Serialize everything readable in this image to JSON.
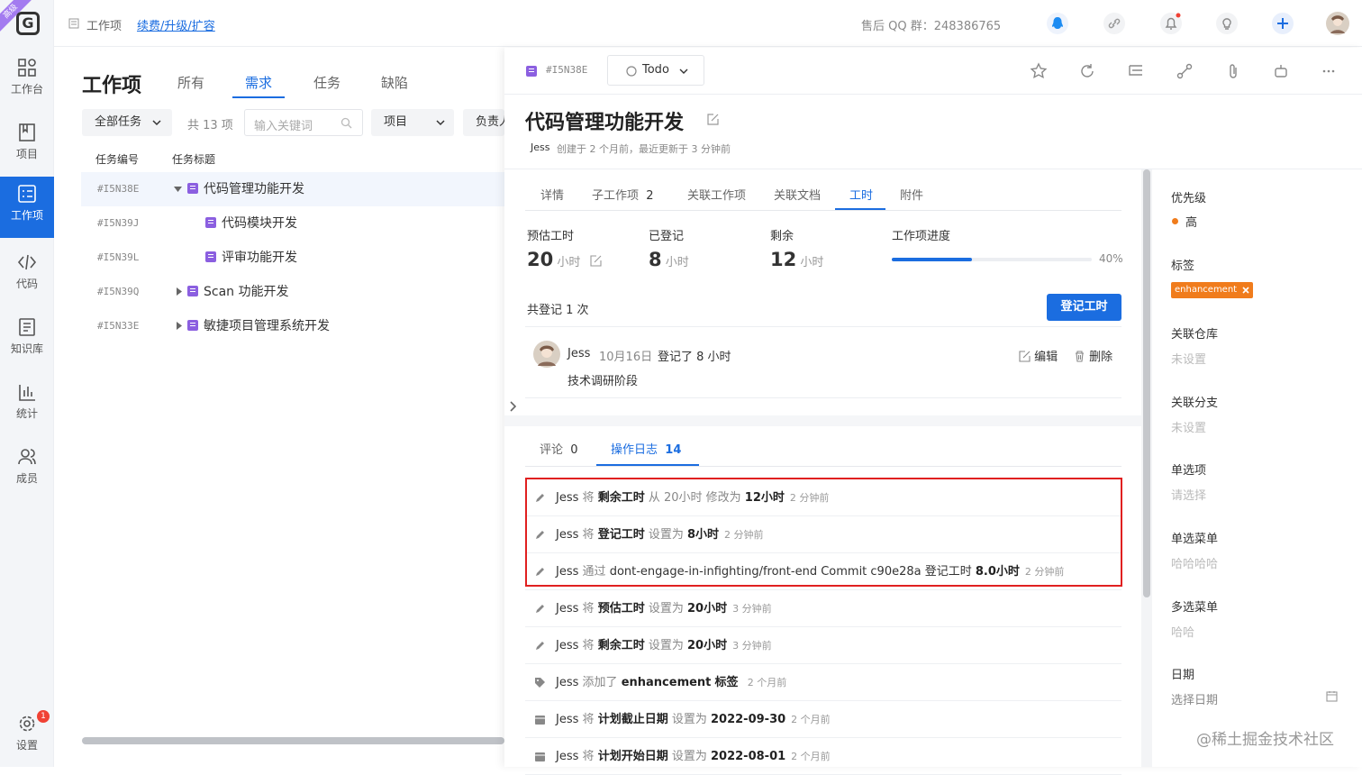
{
  "rail": {
    "corner_badge": "高级",
    "logo_letter": "G",
    "items": [
      {
        "label": "工作台",
        "icon": "dashboard-icon"
      },
      {
        "label": "项目",
        "icon": "project-icon"
      },
      {
        "label": "工作项",
        "icon": "workitem-icon",
        "active": true
      },
      {
        "label": "代码",
        "icon": "code-icon"
      },
      {
        "label": "知识库",
        "icon": "wiki-icon"
      },
      {
        "label": "统计",
        "icon": "chart-icon"
      },
      {
        "label": "成员",
        "icon": "members-icon"
      }
    ],
    "settings_label": "设置",
    "settings_badge": "1"
  },
  "topbar": {
    "crumb_root": "工作项",
    "crumb_link": "续费/升级/扩容",
    "qq_group": "售后 QQ 群：248386765"
  },
  "list": {
    "title": "工作项",
    "tabs": [
      "所有",
      "需求",
      "任务",
      "缺陷"
    ],
    "active_tab": 1,
    "filter_scope": "全部任务",
    "count": "共 13 项",
    "search_placeholder": "输入关键词",
    "project_filter": "项目",
    "assignee_filter": "负责人",
    "col_id": "任务编号",
    "col_title": "任务标题",
    "rows": [
      {
        "id": "#I5N38E",
        "title": "代码管理功能开发",
        "expand": "down",
        "level": 0
      },
      {
        "id": "#I5N39J",
        "title": "代码模块开发",
        "expand": "",
        "level": 1
      },
      {
        "id": "#I5N39L",
        "title": "评审功能开发",
        "expand": "",
        "level": 1
      },
      {
        "id": "#I5N39Q",
        "title": "Scan 功能开发",
        "expand": "right",
        "level": 0
      },
      {
        "id": "#I5N33E",
        "title": "敏捷项目管理系统开发",
        "expand": "right",
        "level": 0
      }
    ]
  },
  "detail": {
    "id": "#I5N38E",
    "status": "Todo",
    "title": "代码管理功能开发",
    "meta_author": "Jess",
    "meta_text": "创建于 2 个月前，最近更新于 3 分钟前",
    "tabs": [
      {
        "label": "详情"
      },
      {
        "label": "子工作项",
        "count": "2"
      },
      {
        "label": "关联工作项"
      },
      {
        "label": "关联文档"
      },
      {
        "label": "工时",
        "active": true
      },
      {
        "label": "附件"
      }
    ],
    "stats": {
      "estimate_label": "预估工时",
      "estimate_value": "20",
      "estimate_unit": "小时",
      "logged_label": "已登记",
      "logged_value": "8",
      "logged_unit": "小时",
      "remain_label": "剩余",
      "remain_value": "12",
      "remain_unit": "小时",
      "progress_label": "工作项进度",
      "progress_text": "40%",
      "progress_value": 0.4
    },
    "logged_count": "共登记 1 次",
    "log_button": "登记工时",
    "entry": {
      "user": "Jess",
      "date": "10月16日",
      "action": "登记了 8 小时",
      "note": "技术调研阶段",
      "edit": "编辑",
      "delete": "删除"
    },
    "activity_tabs": [
      {
        "label": "评论",
        "count": "0"
      },
      {
        "label": "操作日志",
        "count": "14",
        "active": true
      }
    ],
    "logs": [
      {
        "user": "Jess",
        "verb": "将",
        "field": "剩余工时",
        "mid": "从 20小时 修改为",
        "value": "12小时",
        "time": "2 分钟前",
        "icon": "pencil-icon"
      },
      {
        "user": "Jess",
        "verb": "将",
        "field": "登记工时",
        "mid": "设置为",
        "value": "8小时",
        "time": "2 分钟前",
        "icon": "pencil-icon"
      },
      {
        "user": "Jess",
        "verb": "通过",
        "field": "",
        "mid": "dont-engage-in-infighting/front-end Commit c90e28a 登记工时",
        "value": "8.0小时",
        "time": "2 分钟前",
        "icon": "pencil-icon"
      },
      {
        "user": "Jess",
        "verb": "将",
        "field": "预估工时",
        "mid": "设置为",
        "value": "20小时",
        "time": "3 分钟前",
        "icon": "pencil-icon"
      },
      {
        "user": "Jess",
        "verb": "将",
        "field": "剩余工时",
        "mid": "设置为",
        "value": "20小时",
        "time": "3 分钟前",
        "icon": "pencil-icon"
      },
      {
        "user": "Jess",
        "verb": "添加了",
        "field": "enhancement",
        "mid": "标签",
        "value": "",
        "time": "2 个月前",
        "icon": "tag-icon"
      },
      {
        "user": "Jess",
        "verb": "将",
        "field": "计划截止日期",
        "mid": "设置为",
        "value": "2022-09-30",
        "time": "2 个月前",
        "icon": "calendar-icon"
      },
      {
        "user": "Jess",
        "verb": "将",
        "field": "计划开始日期",
        "mid": "设置为",
        "value": "2022-08-01",
        "time": "2 个月前",
        "icon": "calendar-icon"
      }
    ]
  },
  "sidebar": {
    "priority_label": "优先级",
    "priority_value": "高",
    "tag_label": "标签",
    "tag_value": "enhancement",
    "repo_label": "关联仓库",
    "repo_value": "未设置",
    "branch_label": "关联分支",
    "branch_value": "未设置",
    "single_label": "单选项",
    "single_value": "请选择",
    "singlemenu_label": "单选菜单",
    "singlemenu_value": "哈哈哈哈",
    "multi_label": "多选菜单",
    "multi_value": "哈哈",
    "date_label": "日期",
    "date_value": "选择日期"
  },
  "watermark": "@稀土掘金技术社区",
  "colors": {
    "accent": "#1b6de0",
    "highlight": "#e02020",
    "tag": "#f07c1c",
    "type_purple": "#8b5fe0"
  }
}
